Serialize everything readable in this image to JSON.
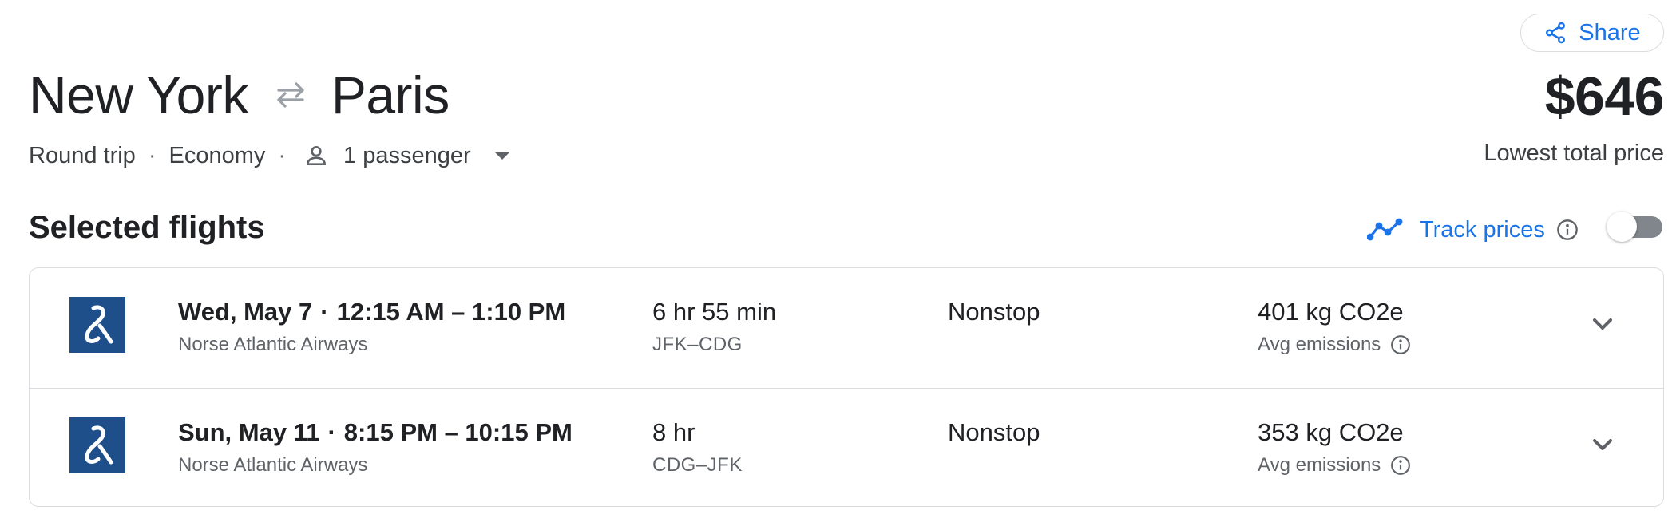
{
  "header": {
    "origin": "New York",
    "destination": "Paris",
    "price": "$646",
    "price_caption": "Lowest total price",
    "share_label": "Share",
    "trip_type": "Round trip",
    "cabin_class": "Economy",
    "passengers": "1 passenger"
  },
  "selected": {
    "title": "Selected flights",
    "track_label": "Track prices",
    "track_enabled": false
  },
  "flights": [
    {
      "date": "Wed, May 7",
      "time_range": "12:15 AM – 1:10 PM",
      "airline": "Norse Atlantic Airways",
      "duration": "6 hr 55 min",
      "route": "JFK–CDG",
      "stops": "Nonstop",
      "emissions": "401 kg CO2e",
      "emissions_label": "Avg emissions"
    },
    {
      "date": "Sun, May 11",
      "time_range": "8:15 PM – 10:15 PM",
      "airline": "Norse Atlantic Airways",
      "duration": "8 hr",
      "route": "CDG–JFK",
      "stops": "Nonstop",
      "emissions": "353 kg CO2e",
      "emissions_label": "Avg emissions"
    }
  ],
  "colors": {
    "accent": "#1a73e8",
    "airline_logo_bg": "#1f4f8b",
    "border": "#dadce0"
  },
  "icons": {
    "share": "share-icon",
    "swap": "swap-arrows-icon",
    "person": "person-icon",
    "trend": "trend-line-icon",
    "info": "info-icon",
    "expand": "chevron-down-icon",
    "airline_logo": "norse-logo"
  }
}
